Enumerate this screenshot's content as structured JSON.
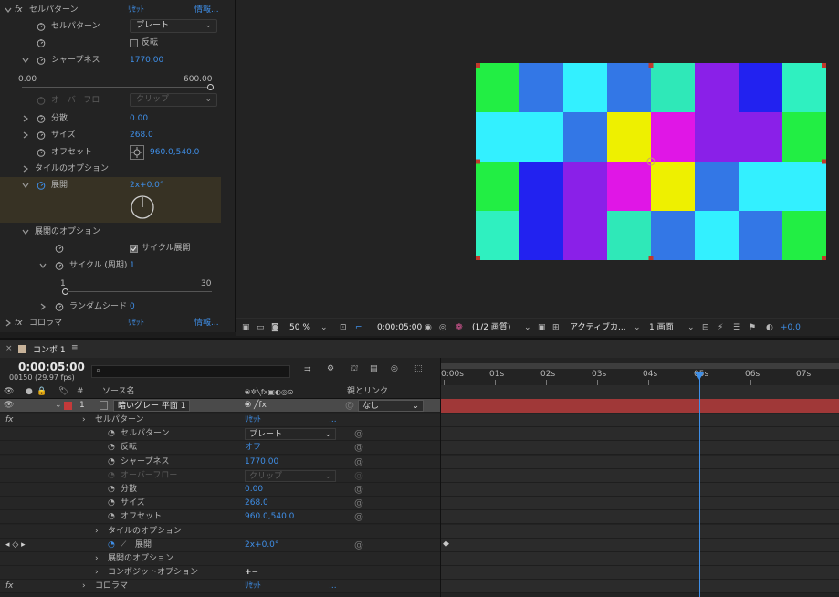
{
  "effect_controls": {
    "fx_header": {
      "fx": "fx",
      "name": "セルパターン",
      "reset": "ﾘｾｯﾄ",
      "info": "情報..."
    },
    "cell_pattern": {
      "label": "セルパターン",
      "value": "プレート"
    },
    "invert": {
      "label": "反転"
    },
    "sharpness": {
      "label": "シャープネス",
      "value": "1770.00",
      "min": "0.00",
      "max": "600.00",
      "slider_fraction": 1.0
    },
    "overflow": {
      "label": "オーバーフロー",
      "value": "クリップ"
    },
    "dispersion": {
      "label": "分散",
      "value": "0.00"
    },
    "size": {
      "label": "サイズ",
      "value": "268.0"
    },
    "offset": {
      "label": "オフセット",
      "value": "960.0,540.0"
    },
    "tile_options": {
      "label": "タイルのオプション"
    },
    "evolution": {
      "label": "展開",
      "value": "2x+0.0°"
    },
    "evolution_options": {
      "label": "展開のオプション"
    },
    "cycle_evolution": {
      "label": "サイクル展開",
      "checked": true
    },
    "cycle": {
      "label": "サイクル (周期)",
      "value": "1",
      "min": "1",
      "max": "30"
    },
    "random_seed": {
      "label": "ランダムシード",
      "value": "0"
    },
    "colorama": {
      "fx": "fx",
      "name": "コロラマ",
      "reset": "ﾘｾｯﾄ",
      "info": "情報..."
    }
  },
  "viewer": {
    "grid_colors": [
      [
        "#22ee44",
        "#3377e6",
        "#33f0ff",
        "#3377e6",
        "#2fe8b8",
        "#8a20e8",
        "#2222f0",
        "#2ff0c0"
      ],
      [
        "#33f0ff",
        "#33f0ff",
        "#3377e6",
        "#eef000",
        "#e016e6",
        "#8a20e8",
        "#8a20e8",
        "#22ee44"
      ],
      [
        "#22ee44",
        "#2222f0",
        "#8a20e8",
        "#e016e6",
        "#eef000",
        "#3377e6",
        "#33f0ff",
        "#33f0ff"
      ],
      [
        "#2ff0c0",
        "#2222f0",
        "#8a20e8",
        "#2fe8b8",
        "#3377e6",
        "#33f0ff",
        "#3377e6",
        "#22ee44"
      ]
    ],
    "toolbar": {
      "zoom": "50 %",
      "timecode": "0:00:05:00",
      "resolution": "(1/2 画質)",
      "camera": "アクティブカ...",
      "views": "1 画面",
      "exposure": "+0.0"
    }
  },
  "timeline": {
    "tab": "コンポ 1",
    "timecode": "0:00:05:00",
    "frames": "00150 (29.97 fps)",
    "search_placeholder": "",
    "col_number": "#",
    "col_source": "ソース名",
    "col_parent": "親とリンク",
    "layer": {
      "number": "1",
      "name": "暗いグレー 平面 1",
      "parent": "なし"
    },
    "rows": {
      "cell_effect": {
        "label": "セルパターン",
        "value": "ﾘｾｯﾄ",
        "more": "..."
      },
      "cell_pattern": {
        "label": "セルパターン",
        "value": "プレート"
      },
      "invert": {
        "label": "反転",
        "value": "オフ"
      },
      "sharpness": {
        "label": "シャープネス",
        "value": "1770.00"
      },
      "overflow": {
        "label": "オーバーフロー",
        "value": "クリップ"
      },
      "dispersion": {
        "label": "分散",
        "value": "0.00"
      },
      "size": {
        "label": "サイズ",
        "value": "268.0"
      },
      "offset": {
        "label": "オフセット",
        "value": "960.0,540.0"
      },
      "tile_options": {
        "label": "タイルのオプション"
      },
      "evolution": {
        "label": "展開",
        "value": "2x+0.0°"
      },
      "evolution_options": {
        "label": "展開のオプション"
      },
      "composite_options": {
        "label": "コンポジットオプション",
        "value": "+−"
      },
      "colorama": {
        "label": "コロラマ",
        "value": "ﾘｾｯﾄ",
        "more": "..."
      }
    },
    "ruler": [
      "0:00s",
      "01s",
      "02s",
      "03s",
      "04s",
      "05s",
      "06s",
      "07s"
    ],
    "playhead_seconds": 5.0,
    "layer_bar_color": "#a03838"
  }
}
